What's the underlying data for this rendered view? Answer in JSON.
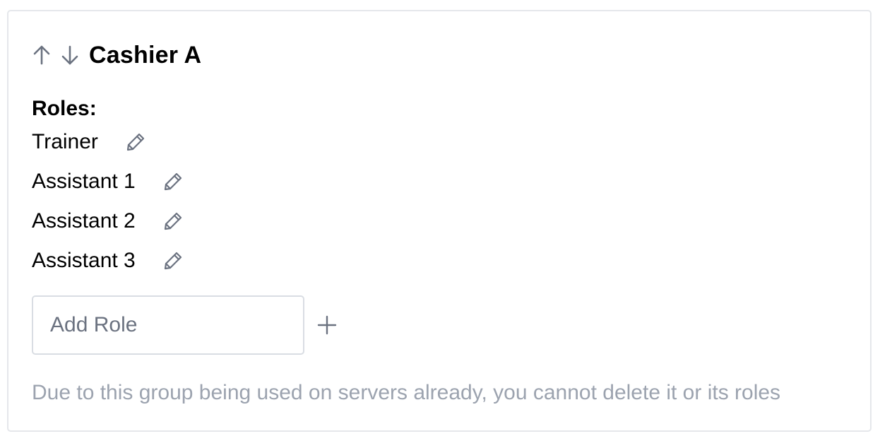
{
  "group": {
    "title": "Cashier A",
    "move_up_icon": "arrow-up-icon",
    "move_down_icon": "arrow-down-icon"
  },
  "roles": {
    "label": "Roles:",
    "items": [
      {
        "name": "Trainer",
        "edit_icon": "pencil-icon"
      },
      {
        "name": "Assistant 1",
        "edit_icon": "pencil-icon"
      },
      {
        "name": "Assistant 2",
        "edit_icon": "pencil-icon"
      },
      {
        "name": "Assistant 3",
        "edit_icon": "pencil-icon"
      }
    ]
  },
  "add_role": {
    "placeholder": "Add Role",
    "value": "",
    "button_icon": "plus-icon"
  },
  "notice": "Due to this group being used on servers already, you cannot delete it or its roles",
  "colors": {
    "icon_gray": "#6b7280",
    "notice_gray": "#9ca3af",
    "border_gray": "#e5e7eb"
  }
}
